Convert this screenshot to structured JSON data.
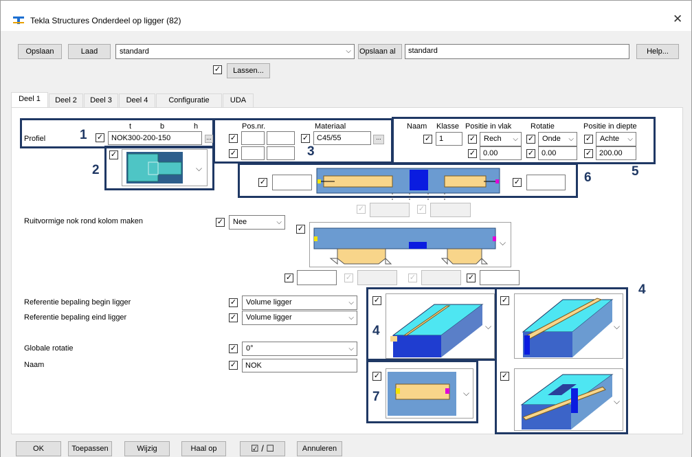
{
  "window": {
    "title": "Tekla Structures  Onderdeel op ligger (82)"
  },
  "toolbar": {
    "save_label": "Opslaan",
    "load_label": "Laad",
    "load_value": "standard",
    "save_as_label": "Opslaan al",
    "save_as_value": "standard",
    "help_label": "Help...",
    "welds_label": "Lassen..."
  },
  "tabs": [
    "Deel 1",
    "Deel 2",
    "Deel 3",
    "Deel 4",
    "Configuratie",
    "UDA"
  ],
  "profile": {
    "label": "Profiel",
    "col_t": "t",
    "col_b": "b",
    "col_h": "h",
    "value": "NOK300-200-150",
    "browse": "..."
  },
  "posnr": {
    "label": "Pos.nr."
  },
  "material": {
    "label": "Materiaal",
    "value": "C45/55",
    "browse": "..."
  },
  "placement": {
    "naam_label": "Naam",
    "klasse_label": "Klasse",
    "klasse_value": "1",
    "pos_vlak_label": "Positie in vlak",
    "pos_vlak_value": "Rech",
    "pos_vlak_offset": "0.00",
    "rotatie_label": "Rotatie",
    "rotatie_value": "Onde",
    "rotatie_offset": "0.00",
    "pos_diepte_label": "Positie in diepte",
    "pos_diepte_value": "Achte",
    "pos_diepte_offset": "200.00"
  },
  "callouts": [
    "1",
    "2",
    "3",
    "4",
    "4",
    "5",
    "6",
    "7"
  ],
  "ruit": {
    "label": "Ruitvormige nok rond kolom maken",
    "value": "Nee"
  },
  "ref_begin": {
    "label": "Referentie bepaling begin ligger",
    "value": "Volume ligger"
  },
  "ref_end": {
    "label": "Referentie bepaling eind ligger",
    "value": "Volume ligger"
  },
  "global_rotation": {
    "label": "Globale rotatie",
    "value": "0°"
  },
  "name": {
    "label": "Naam",
    "value": "NOK"
  },
  "bottom": {
    "ok": "OK",
    "apply": "Toepassen",
    "modify": "Wijzig",
    "get": "Haal op",
    "toggle": "☑ / ☐",
    "cancel": "Annuleren"
  },
  "colors": {
    "accent_navy": "#1f3864",
    "cyan": "#4ec5c5",
    "steel_blue": "#6b9bd1",
    "beam_yellow": "#f8d58a",
    "column_blue": "#0a1ce0"
  }
}
